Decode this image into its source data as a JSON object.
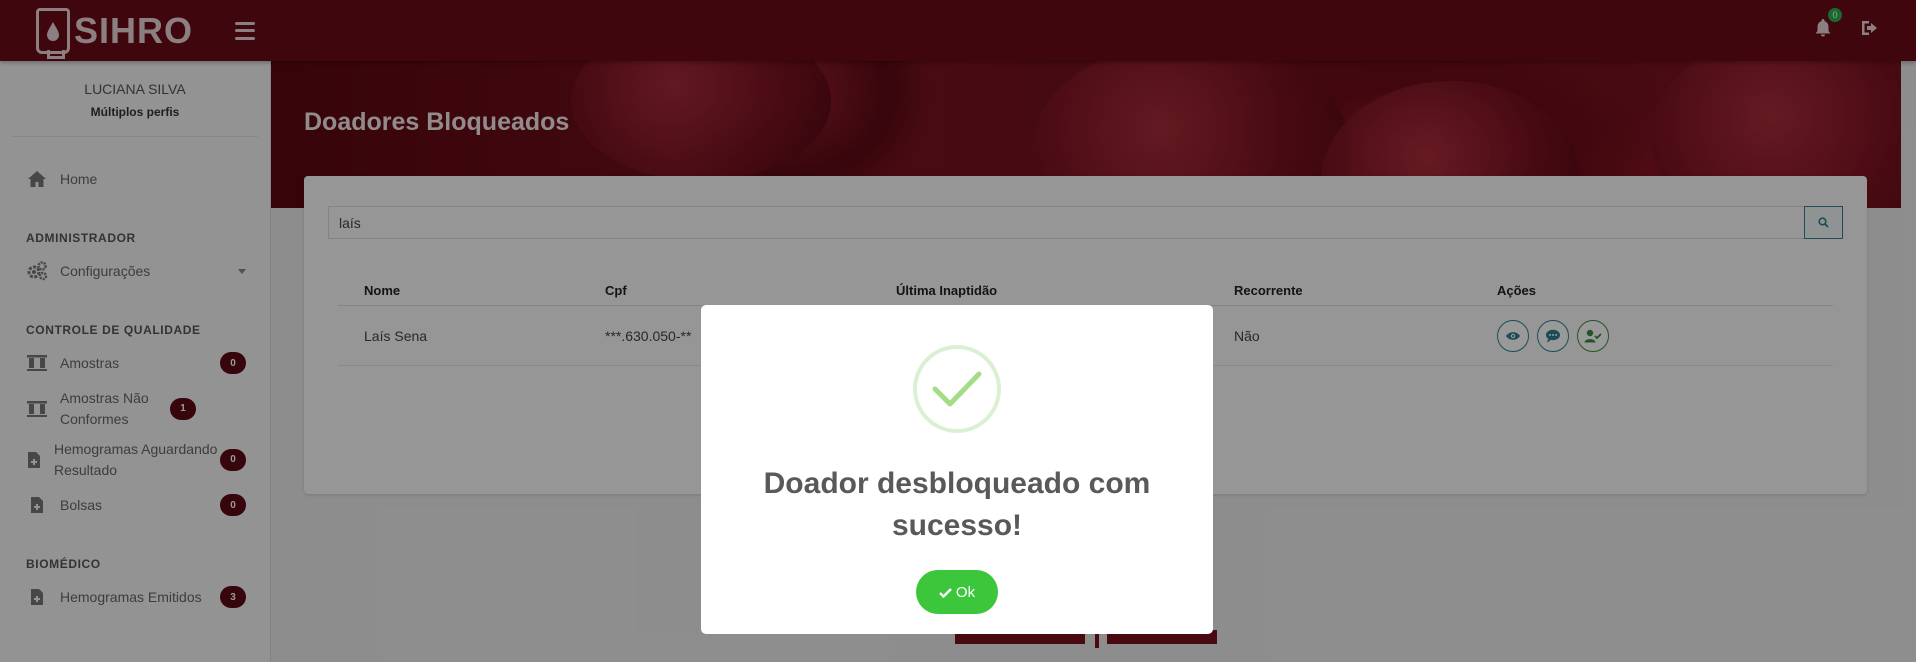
{
  "app": {
    "logo_text": "SIHRO",
    "notification_count": "0"
  },
  "user": {
    "name": "LUCIANA SILVA",
    "profile": "Múltiplos perfis"
  },
  "sidebar": {
    "home": "Home",
    "sections": [
      {
        "title": "ADMINISTRADOR",
        "items": [
          {
            "label": "Configurações"
          }
        ]
      },
      {
        "title": "CONTROLE DE QUALIDADE",
        "items": [
          {
            "label": "Amostras",
            "count": "0"
          },
          {
            "label": "Amostras Não Conformes",
            "count": "1"
          },
          {
            "label": "Hemogramas Aguardando Resultado",
            "count": "0"
          },
          {
            "label": "Bolsas",
            "count": "0"
          }
        ]
      },
      {
        "title": "BIOMÉDICO",
        "items": [
          {
            "label": "Hemogramas Emitidos",
            "count": "3"
          }
        ]
      }
    ]
  },
  "page": {
    "title": "Doadores Bloqueados"
  },
  "search": {
    "value": "laís"
  },
  "table": {
    "headers": [
      "Nome",
      "Cpf",
      "Última Inaptidão",
      "Recorrente",
      "Ações"
    ],
    "rows": [
      {
        "nome": "Laís Sena",
        "cpf": "***.630.050-**",
        "ultima_inaptidao": "",
        "recorrente": "Não"
      }
    ]
  },
  "modal": {
    "title": "Doador desbloqueado com sucesso!",
    "ok_label": "Ok"
  },
  "colors": {
    "brand": "#6a0a17",
    "badge": "#5b0a14",
    "success": "#3cc63c",
    "teal": "#2f7f8f"
  },
  "icons": [
    "hamburger-icon",
    "bell-icon",
    "logout-icon",
    "home-icon",
    "cogs-icon",
    "flask-icon",
    "file-plus-icon",
    "search-icon",
    "eye-icon",
    "comment-icon",
    "user-check-icon",
    "check-icon"
  ]
}
